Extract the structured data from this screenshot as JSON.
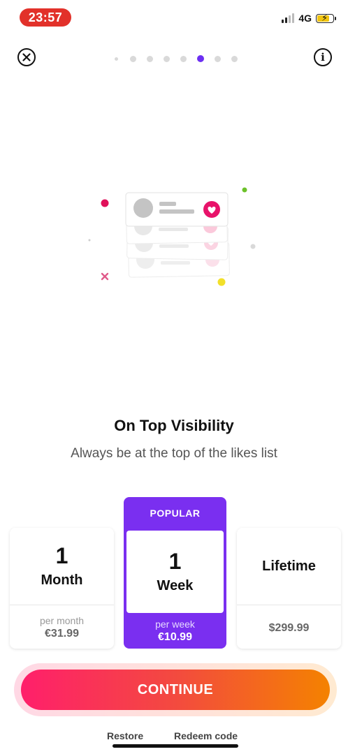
{
  "status_bar": {
    "time": "23:57",
    "network": "4G"
  },
  "header": {
    "steps_total": 8,
    "active_step": 6
  },
  "icons": {
    "close": "close-circle-icon",
    "info": "info-circle-icon",
    "heart": "heart-icon"
  },
  "colors": {
    "accent": "#7a2ff0",
    "gradient_start": "#ff1f6b",
    "gradient_end": "#f48200",
    "status_pill": "#e2312a"
  },
  "feature": {
    "title": "On Top Visibility",
    "subtitle": "Always be at the top of the likes list"
  },
  "plans": [
    {
      "number": "1",
      "unit": "Month",
      "per": "per month",
      "price": "€31.99"
    },
    {
      "badge": "POPULAR",
      "number": "1",
      "unit": "Week",
      "per": "per week",
      "price": "€10.99",
      "selected": true
    },
    {
      "label": "Lifetime",
      "price": "$299.99"
    }
  ],
  "cta": {
    "label": "CONTINUE"
  },
  "footer": {
    "restore": "Restore",
    "redeem": "Redeem code"
  }
}
